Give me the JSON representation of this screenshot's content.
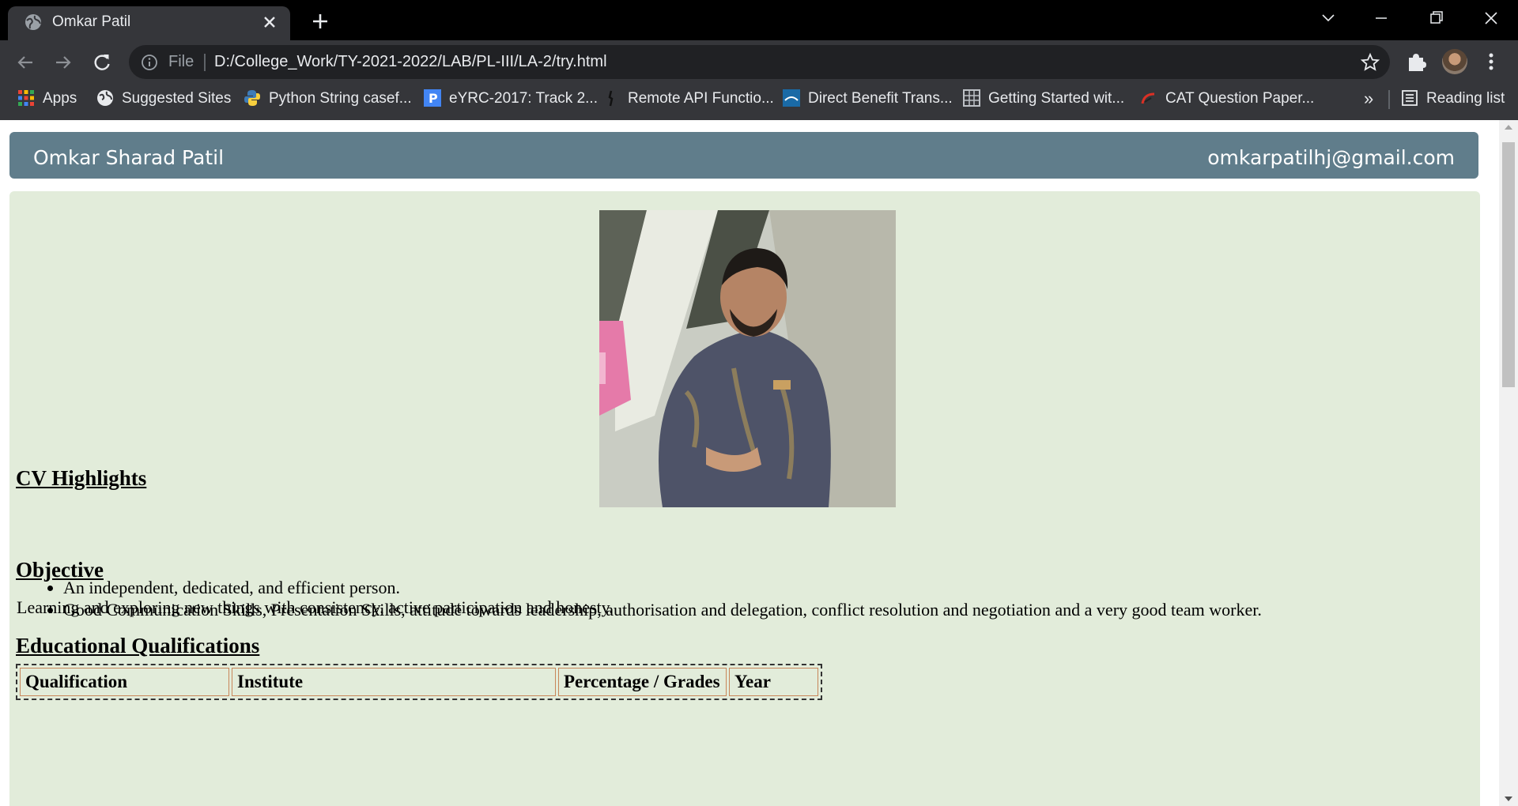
{
  "browser": {
    "tab": {
      "title": "Omkar Patil"
    },
    "omnibox": {
      "scheme_label": "File",
      "url": "D:/College_Work/TY-2021-2022/LAB/PL-III/LA-2/try.html"
    },
    "bookmarks": [
      {
        "label": "Apps",
        "icon": "apps-grid-icon"
      },
      {
        "label": "Suggested Sites",
        "icon": "globe-icon"
      },
      {
        "label": "Python String casef...",
        "icon": "python-icon"
      },
      {
        "label": "eYRC-2017: Track 2...",
        "icon": "p-badge-icon"
      },
      {
        "label": "Remote API Functio...",
        "icon": "figure-icon"
      },
      {
        "label": "Direct Benefit Trans...",
        "icon": "dbt-icon"
      },
      {
        "label": "Getting Started wit...",
        "icon": "grid-icon"
      },
      {
        "label": "CAT Question Paper...",
        "icon": "cat-icon"
      }
    ],
    "overflow_label": "»",
    "reading_list_label": "Reading list"
  },
  "page": {
    "header": {
      "name": "Omkar Sharad Patil",
      "email": "omkarpatilhj@gmail.com"
    },
    "cv_highlights": {
      "heading": "CV Highlights",
      "items": [
        "An independent, dedicated, and efficient person.",
        "Good Communication Skills, Presentation Skills, attitude towards leadership, authorisation and delegation, conflict resolution and negotiation and a very good team worker."
      ]
    },
    "objective": {
      "heading": "Objective",
      "text": "Learning and exploring new things with consistency, active participation and honesty."
    },
    "education": {
      "heading": "Educational Qualifications",
      "columns": [
        "Qualification",
        "Institute",
        "Percentage / Grades",
        "Year"
      ]
    }
  },
  "colors": {
    "header_bg": "#607d8b",
    "content_bg": "#e2ecda",
    "chrome_dark": "#35363a"
  }
}
